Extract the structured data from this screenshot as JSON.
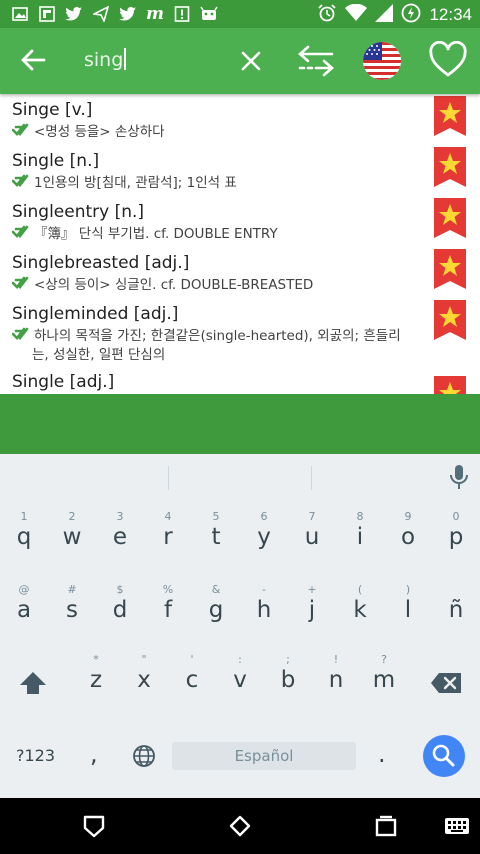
{
  "status_bar": {
    "time": "12:34",
    "left_icons": [
      "image-icon",
      "flipboard-icon",
      "twitter-icon",
      "send-icon",
      "twitter-icon",
      "m-icon",
      "alert-icon",
      "android-icon"
    ],
    "right_icons": [
      "alarm-icon",
      "wifi-icon",
      "signal-icon",
      "battery-icon"
    ]
  },
  "app_bar": {
    "search_value": "sing",
    "colors": {
      "primary": "#4caf50",
      "status": "#3d9a3a"
    }
  },
  "results": [
    {
      "word": "Singe [v.]",
      "definition": "<명성 등을> 손상하다"
    },
    {
      "word": "Single [n.]",
      "definition": "1인용의 방[침대, 관람석]; 1인석 표"
    },
    {
      "word": "Singleentry [n.]",
      "definition": "『簿』 단식 부기법. cf. DOUBLE ENTRY"
    },
    {
      "word": "Singlebreasted [adj.]",
      "definition": "<상의 등이> 싱글인. cf. DOUBLE-BREASTED"
    },
    {
      "word": "Singleminded [adj.]",
      "definition": "하나의 목적을 가진; 한결같은(single-hearted), 외곬의; 흔들리",
      "definition_cont": "는, 성실한, 일편 단심의"
    },
    {
      "word": "Single [adj.]",
      "definition": ""
    }
  ],
  "keyboard": {
    "row1": [
      {
        "hint": "1",
        "key": "q"
      },
      {
        "hint": "2",
        "key": "w"
      },
      {
        "hint": "3",
        "key": "e"
      },
      {
        "hint": "4",
        "key": "r"
      },
      {
        "hint": "5",
        "key": "t"
      },
      {
        "hint": "6",
        "key": "y"
      },
      {
        "hint": "7",
        "key": "u"
      },
      {
        "hint": "8",
        "key": "i"
      },
      {
        "hint": "9",
        "key": "o"
      },
      {
        "hint": "0",
        "key": "p"
      }
    ],
    "row2": [
      {
        "hint": "@",
        "key": "a"
      },
      {
        "hint": "#",
        "key": "s"
      },
      {
        "hint": "$",
        "key": "d"
      },
      {
        "hint": "%",
        "key": "f"
      },
      {
        "hint": "&",
        "key": "g"
      },
      {
        "hint": "-",
        "key": "h"
      },
      {
        "hint": "+",
        "key": "j"
      },
      {
        "hint": "(",
        "key": "k"
      },
      {
        "hint": ")",
        "key": "l"
      },
      {
        "hint": "",
        "key": "ñ"
      }
    ],
    "row3": [
      {
        "hint": "*",
        "key": "z"
      },
      {
        "hint": "\"",
        "key": "x"
      },
      {
        "hint": "'",
        "key": "c"
      },
      {
        "hint": ":",
        "key": "v"
      },
      {
        "hint": ";",
        "key": "b"
      },
      {
        "hint": "!",
        "key": "n"
      },
      {
        "hint": "?",
        "key": "m"
      }
    ],
    "symbols_label": "?123",
    "comma_label": ",",
    "period_label": ".",
    "space_label": "Español",
    "accent_color": "#4285f4"
  },
  "nav_bar": {
    "icons": [
      "back-icon",
      "home-icon",
      "recents-icon",
      "keyboard-icon"
    ]
  }
}
